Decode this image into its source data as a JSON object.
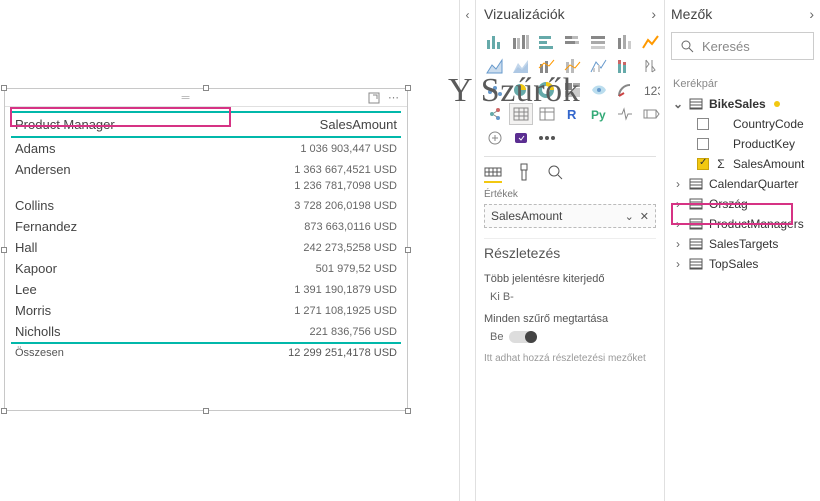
{
  "overlay": "Y Szűrők",
  "visual": {
    "columns": [
      "Product Manager",
      "SalesAmount"
    ],
    "rows": [
      {
        "name": "Adams",
        "value": "1 036 903,447 USD",
        "sub": ""
      },
      {
        "name": "Andersen",
        "value": "1 363 667,4521 USD",
        "sub": "1 236 781,7098 USD"
      },
      {
        "name": "Collins",
        "value": "3 728 206,0198 USD",
        "sub": ""
      },
      {
        "name": "Fernandez",
        "value": "873 663,0116 USD",
        "sub": ""
      },
      {
        "name": "Hall",
        "value": "242 273,5258 USD",
        "sub": ""
      },
      {
        "name": "Kapoor",
        "value": "501 979,52 USD",
        "sub": ""
      },
      {
        "name": "Lee",
        "value": "1 391 190,1879 USD",
        "sub": ""
      },
      {
        "name": "Morris",
        "value": "1 271 108,1925 USD",
        "sub": ""
      },
      {
        "name": "Nicholls",
        "value": "221 836,756 USD",
        "sub": ""
      }
    ],
    "total_label": "Összesen",
    "total_value": "12 299 251,4178 USD"
  },
  "viz_pane": {
    "title": "Vizualizációk",
    "values_label": "Értékek",
    "well_value": "SalesAmount",
    "drill_title": "Részletezés",
    "cross_report": "Több jelentésre kiterjedő",
    "cross_toggle": "Ki B-",
    "keep_all": "Minden szűrő megtartása",
    "keep_toggle": "Be",
    "drop_hint": "Itt adhat hozzá részletezési mezőket"
  },
  "fields_pane": {
    "title": "Mezők",
    "search_placeholder": "Keresés",
    "group_label": "Kerékpár",
    "tables": [
      {
        "name": "BikeSales",
        "expanded": true,
        "active": true,
        "fields": [
          {
            "name": "CountryCode",
            "checked": false,
            "sigma": false
          },
          {
            "name": "ProductKey",
            "checked": false,
            "sigma": false
          },
          {
            "name": "SalesAmount",
            "checked": true,
            "sigma": true
          }
        ]
      },
      {
        "name": "CalendarQuarter",
        "expanded": false
      },
      {
        "name": "Ország",
        "expanded": false
      },
      {
        "name": "ProductManagers",
        "expanded": false
      },
      {
        "name": "SalesTargets",
        "expanded": false
      },
      {
        "name": "TopSales",
        "expanded": false
      }
    ]
  }
}
